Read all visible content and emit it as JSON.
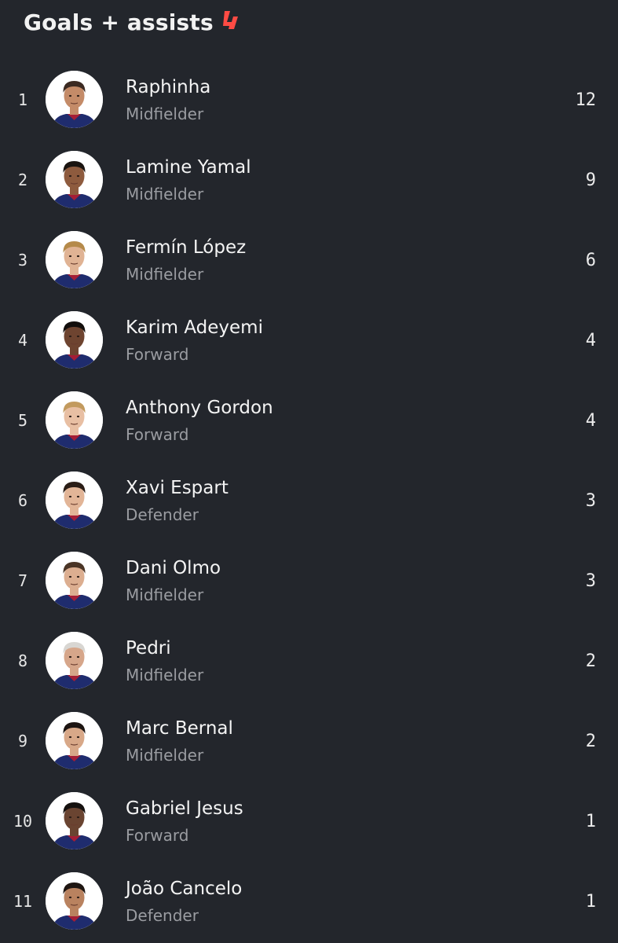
{
  "header": {
    "title": "Goals + assists",
    "logo_icon": "laliga-logo-icon",
    "logo_color": "#ff4b44"
  },
  "players": [
    {
      "rank": "1",
      "name": "Raphinha",
      "position": "Midfielder",
      "value": "12",
      "hair": "#3b2a22",
      "skin": "#c48b68"
    },
    {
      "rank": "2",
      "name": "Lamine Yamal",
      "position": "Midfielder",
      "value": "9",
      "hair": "#1a1410",
      "skin": "#8e5b3e"
    },
    {
      "rank": "3",
      "name": "Fermín López",
      "position": "Midfielder",
      "value": "6",
      "hair": "#b58a4a",
      "skin": "#e0b394"
    },
    {
      "rank": "4",
      "name": "Karim Adeyemi",
      "position": "Forward",
      "value": "4",
      "hair": "#120e0c",
      "skin": "#6e4430"
    },
    {
      "rank": "5",
      "name": "Anthony Gordon",
      "position": "Forward",
      "value": "4",
      "hair": "#c29a5e",
      "skin": "#e8bfa3"
    },
    {
      "rank": "6",
      "name": "Xavi Espart",
      "position": "Defender",
      "value": "3",
      "hair": "#2a1d16",
      "skin": "#e2b597"
    },
    {
      "rank": "7",
      "name": "Dani Olmo",
      "position": "Midfielder",
      "value": "3",
      "hair": "#4a3526",
      "skin": "#dcae90"
    },
    {
      "rank": "8",
      "name": "Pedri",
      "position": "Midfielder",
      "value": "2",
      "hair": "#d8d6d2",
      "skin": "#d6a68a"
    },
    {
      "rank": "9",
      "name": "Marc Bernal",
      "position": "Midfielder",
      "value": "2",
      "hair": "#1c1512",
      "skin": "#d8a888"
    },
    {
      "rank": "10",
      "name": "Gabriel Jesus",
      "position": "Forward",
      "value": "1",
      "hair": "#15110f",
      "skin": "#6a4431"
    },
    {
      "rank": "11",
      "name": "João Cancelo",
      "position": "Defender",
      "value": "1",
      "hair": "#1e1612",
      "skin": "#b9825f"
    }
  ],
  "colors": {
    "background": "#23262c",
    "jersey": "#1f2c6e",
    "jersey_accent": "#a51d36"
  }
}
